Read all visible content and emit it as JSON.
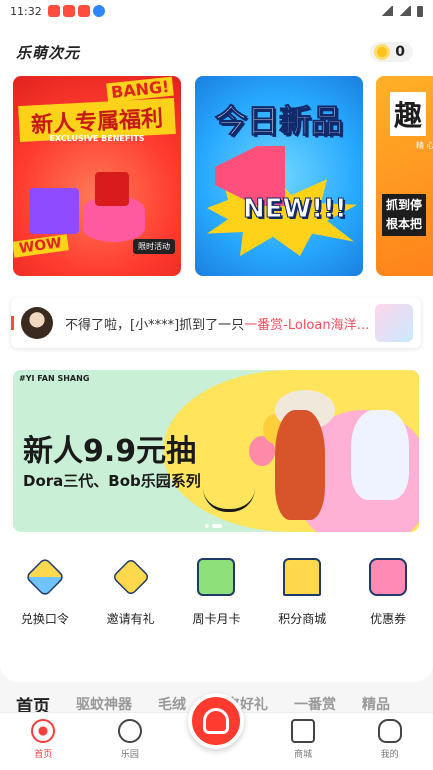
{
  "status_bar": {
    "time": "11:32"
  },
  "header": {
    "title": "乐萌次元",
    "coin_count": "0"
  },
  "cards": [
    {
      "bang": "BANG!",
      "title": "新人专属福利",
      "subtitle": "EXCLUSIVE BENEFITS",
      "wow": "WOW",
      "badge": "限时活动"
    },
    {
      "title": "今日新品",
      "new_text": "NEW!!!"
    },
    {
      "title": "趣",
      "subtitle": "精 心",
      "lines": "抓到停\n根本把"
    }
  ],
  "ticker": {
    "text": "不得了啦，[小****]抓到了一只",
    "highlight": "一番赏-Loloan海洋…"
  },
  "banner": {
    "tag": "#YI FAN SHANG",
    "title": "新人9.9元抽",
    "subtitle": "Dora三代、Bob乐园系列"
  },
  "features": [
    {
      "label": "兑换口令",
      "icon": "exchange-code-icon"
    },
    {
      "label": "邀请有礼",
      "icon": "invite-gift-icon"
    },
    {
      "label": "周卡月卡",
      "icon": "week-month-card-icon"
    },
    {
      "label": "积分商城",
      "icon": "points-mall-icon"
    },
    {
      "label": "优惠券",
      "icon": "coupon-icon"
    }
  ],
  "category_tabs": [
    "首页",
    "驱蚊神器",
    "毛绒",
    "七夕好礼",
    "一番赏",
    "精品"
  ],
  "bottom_nav": [
    {
      "label": "首页",
      "icon": "home-planet-icon",
      "active": true
    },
    {
      "label": "乐园",
      "icon": "park-icon"
    },
    {
      "label": "",
      "icon": "lottery-machine-icon"
    },
    {
      "label": "商城",
      "icon": "shop-icon"
    },
    {
      "label": "我的",
      "icon": "profile-icon"
    }
  ],
  "colors": {
    "accent": "#ff3d3d",
    "highlight": "#ff4a5c"
  }
}
